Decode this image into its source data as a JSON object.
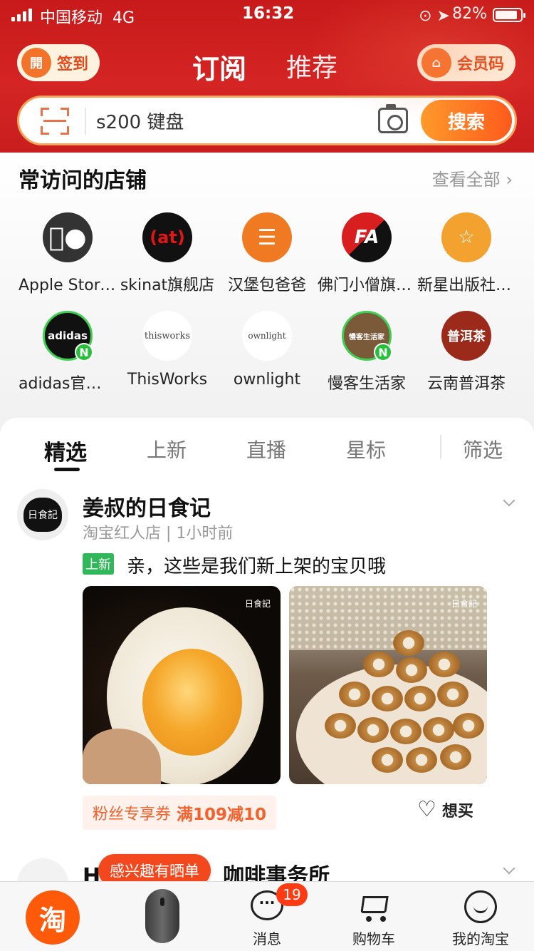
{
  "status_bar": {
    "carrier": "中国移动",
    "network": "4G",
    "time": "16:32",
    "battery": "82%"
  },
  "header": {
    "checkin_label": "签到",
    "checkin_icon_text": "開",
    "tabs": [
      {
        "label": "订阅",
        "active": true
      },
      {
        "label": "推荐",
        "active": false
      }
    ],
    "member_code_label": "会员码"
  },
  "search": {
    "value": "s200 键盘",
    "button_label": "搜索"
  },
  "frequent_stores": {
    "title": "常访问的店铺",
    "view_all": "查看全部 ›",
    "stores": [
      {
        "name": "Apple Store 官方旗舰店",
        "logo_text": "",
        "logo_color": "#333333",
        "has_new": false
      },
      {
        "name": "skinat旗舰店",
        "logo_text": "(at)",
        "logo_color": "#111111",
        "has_new": false
      },
      {
        "name": "汉堡包爸爸",
        "logo_text": "☰",
        "logo_color": "#f07a22",
        "has_new": false
      },
      {
        "name": "佛门小僧旗舰店",
        "logo_text": "FA",
        "logo_color": "#d81e1e",
        "has_new": false
      },
      {
        "name": "新星出版社官方旗舰店",
        "logo_text": "☆",
        "logo_color": "#f3a12f",
        "has_new": false
      },
      {
        "name": "adidas官方旗舰店",
        "logo_text": "adidas",
        "logo_color": "#111111",
        "has_new": true
      },
      {
        "name": "ThisWorks",
        "logo_text": "thisworks",
        "logo_color": "#ffffff",
        "has_new": false
      },
      {
        "name": "ownlight",
        "logo_text": "ownlight",
        "logo_color": "#ffffff",
        "has_new": false
      },
      {
        "name": "慢客生活家",
        "logo_text": "慢客生活家",
        "logo_color": "#7b5a3a",
        "has_new": true
      },
      {
        "name": "云南普洱茶",
        "logo_text": "普洱茶",
        "logo_color": "#9b2a1a",
        "has_new": false
      }
    ]
  },
  "feed": {
    "tabs": [
      {
        "label": "精选",
        "active": true
      },
      {
        "label": "上新"
      },
      {
        "label": "直播"
      },
      {
        "label": "星标"
      }
    ],
    "filter_label": "筛选",
    "post": {
      "avatar_text": "日食記",
      "shop_name": "姜叔的日食记",
      "meta": "淘宝红人店 | 1小时前",
      "tag": "上新",
      "text": "亲，这些是我们新上架的宝贝哦",
      "photo_mark": "日食記",
      "coupon_label": "粉丝专享券",
      "coupon_value": "满109减10",
      "wish_label": "想买"
    },
    "post2": {
      "shop_name_visible": "H",
      "shop_name_tail": "咖啡事务所"
    }
  },
  "tooltip": "感兴趣有晒单",
  "bottom_nav": {
    "items": [
      {
        "label": "",
        "icon": "taobao-icon",
        "icon_text": "淘"
      },
      {
        "label": "",
        "icon": "mouse-product-icon"
      },
      {
        "label": "消息",
        "icon": "message-icon",
        "badge": "19"
      },
      {
        "label": "购物车",
        "icon": "cart-icon"
      },
      {
        "label": "我的淘宝",
        "icon": "profile-smile-icon"
      }
    ]
  }
}
